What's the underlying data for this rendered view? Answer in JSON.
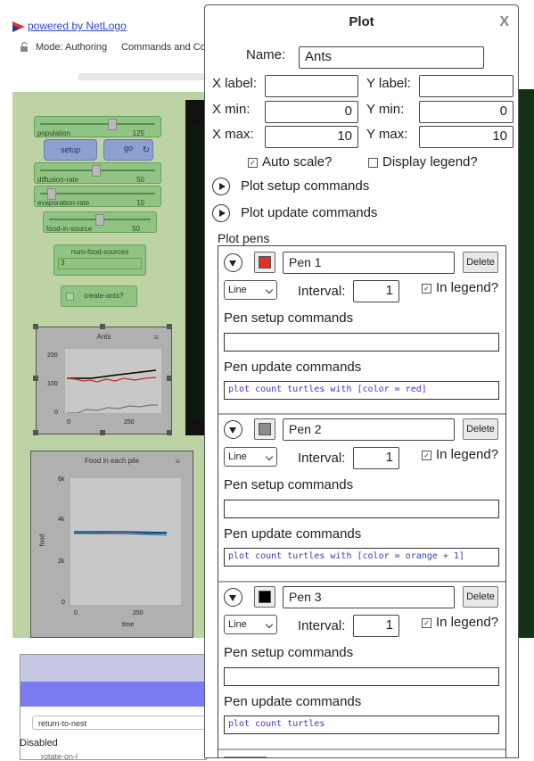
{
  "header": {
    "powered_by": "powered by NetLogo",
    "mode": "Mode: Authoring",
    "commands_and_code": "Commands and Code"
  },
  "widgets": {
    "population": {
      "label": "population",
      "value": "125"
    },
    "setup_label": "setup",
    "go_label": "go",
    "diffusion_rate": {
      "label": "diffusion-rate",
      "value": "50"
    },
    "evaporation_rate": {
      "label": "evaporation-rate",
      "value": "10"
    },
    "food_in_source": {
      "label": "food-in-source",
      "value": "50"
    },
    "num_food_sources": {
      "label": "num-food-sources",
      "value": "3"
    },
    "create_ants_label": "create-ants?"
  },
  "ants_plot": {
    "title": "Ants",
    "y_ticks": [
      "200",
      "100",
      "0"
    ],
    "x_ticks": [
      "0",
      "250"
    ]
  },
  "food_plot": {
    "title": "Food in each pile",
    "y_ticks": [
      "6k",
      "4k",
      "2k",
      "0"
    ],
    "x_ticks": [
      "0",
      "250"
    ],
    "ylabel": "food",
    "xlabel": "time"
  },
  "command_panel": {
    "procedure": "return-to-nest",
    "status": "Disabled",
    "next_line": "rotate-on-l"
  },
  "dialog": {
    "title": "Plot",
    "close": "X",
    "name_label": "Name:",
    "name_value": "Ants",
    "xlabel_label": "X label:",
    "xlabel_value": "",
    "ylabel_label": "Y label:",
    "ylabel_value": "",
    "xmin_label": "X min:",
    "xmin_value": "0",
    "ymin_label": "Y min:",
    "ymin_value": "0",
    "xmax_label": "X max:",
    "xmax_value": "10",
    "ymax_label": "Y max:",
    "ymax_value": "10",
    "autoscale_label": "Auto scale?",
    "autoscale_checked": true,
    "display_legend_label": "Display legend?",
    "display_legend_checked": false,
    "setup_commands_label": "Plot setup commands",
    "update_commands_label": "Plot update commands",
    "pens_label": "Plot pens",
    "pens": [
      {
        "name": "Pen 1",
        "color": "#e0302a",
        "delete": "Delete",
        "mode": "Line",
        "interval_label": "Interval:",
        "interval": "1",
        "in_legend_label": "In legend?",
        "setup_label": "Pen setup commands",
        "setup_code": "",
        "update_label": "Pen update commands",
        "update_code": "plot count turtles with [color = red]"
      },
      {
        "name": "Pen 2",
        "color": "#8c8c8c",
        "delete": "Delete",
        "mode": "Line",
        "interval_label": "Interval:",
        "interval": "1",
        "in_legend_label": "In legend?",
        "setup_label": "Pen setup commands",
        "setup_code": "",
        "update_label": "Pen update commands",
        "update_code": "plot count turtles with [color = orange + 1]"
      },
      {
        "name": "Pen 3",
        "color": "#000000",
        "delete": "Delete",
        "mode": "Line",
        "interval_label": "Interval:",
        "interval": "1",
        "in_legend_label": "In legend?",
        "setup_label": "Pen setup commands",
        "setup_code": "",
        "update_label": "Pen update commands",
        "update_code": "plot count turtles"
      }
    ]
  }
}
